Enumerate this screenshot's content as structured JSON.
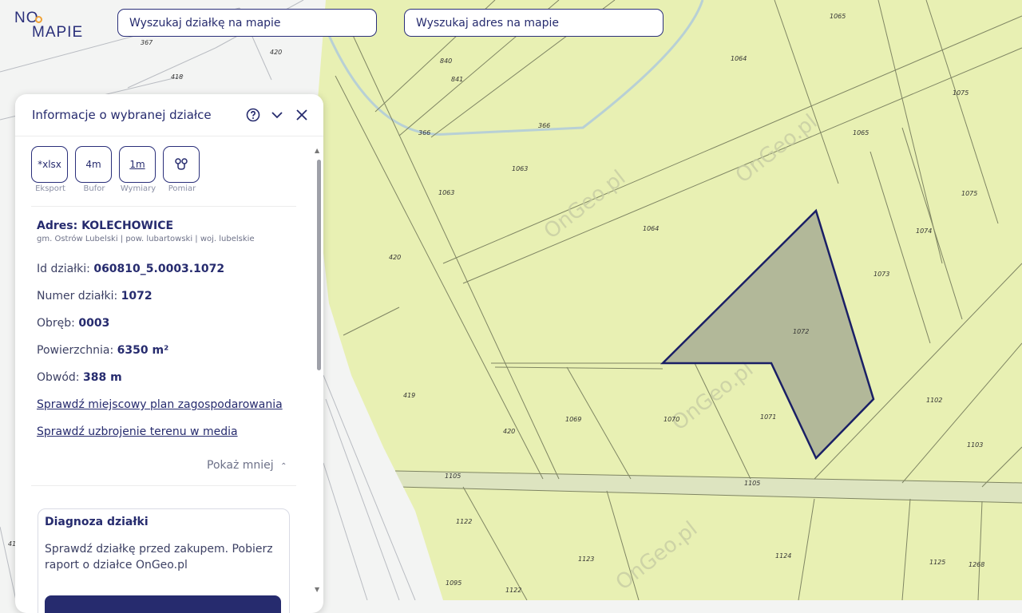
{
  "brand": {
    "line1": "NO",
    "line2": "MAPIE",
    "accent": "#f0a236"
  },
  "search": {
    "plot_placeholder": "Wyszukaj działkę na mapie",
    "address_placeholder": "Wyszukaj adres na mapie"
  },
  "panel": {
    "title": "Informacje o wybranej działce",
    "help_icon": "help-icon",
    "collapse_icon": "chevron-down-icon",
    "close_icon": "close-icon",
    "tools": [
      {
        "icon_text": "*xlsx",
        "label": "Eksport"
      },
      {
        "icon_text": "4m",
        "label": "Bufor"
      },
      {
        "icon_text": "1m",
        "label": "Wymiary"
      },
      {
        "icon_text": "",
        "label": "Pomiar"
      }
    ],
    "address": {
      "label": "Adres:",
      "value": "KOLECHOWICE",
      "sub": "gm. Ostrów Lubelski | pow. lubartowski | woj. lubelskie"
    },
    "fields": [
      {
        "label": "Id działki:",
        "value": "060810_5.0003.1072"
      },
      {
        "label": "Numer działki:",
        "value": "1072"
      },
      {
        "label": "Obręb:",
        "value": "0003"
      },
      {
        "label": "Powierzchnia:",
        "value": "6350 m²"
      },
      {
        "label": "Obwód:",
        "value": "388 m"
      }
    ],
    "links": [
      "Sprawdź miejscowy plan zagospodarowania",
      "Sprawdź uzbrojenie terenu w media"
    ],
    "show_less": "Pokaż mniej",
    "diagnosis": {
      "title": "Diagnoza działki",
      "text": "Sprawdź działkę przed zakupem. Pobierz raport o działce OnGeo.pl"
    }
  },
  "map": {
    "colors": {
      "zone": "#e8f0b3",
      "background": "#f3f4f3",
      "plot_fill": "#a8ae94",
      "plot_border": "#1a1f66",
      "line": "#7f8563",
      "road": "#dde4c0"
    },
    "selected_parcel": "1072",
    "watermark": "OnGeo.pl",
    "parcel_labels": [
      "367",
      "420",
      "418",
      "840",
      "841",
      "366",
      "366",
      "1063",
      "1063",
      "1064",
      "1064",
      "1065",
      "1065",
      "1075",
      "1075",
      "1074",
      "1073",
      "1072",
      "420",
      "419",
      "420",
      "1069",
      "1070",
      "1071",
      "1102",
      "1103",
      "1105",
      "1105",
      "1122",
      "1123",
      "1124",
      "1125",
      "1268",
      "1095",
      "1122",
      "41"
    ]
  }
}
